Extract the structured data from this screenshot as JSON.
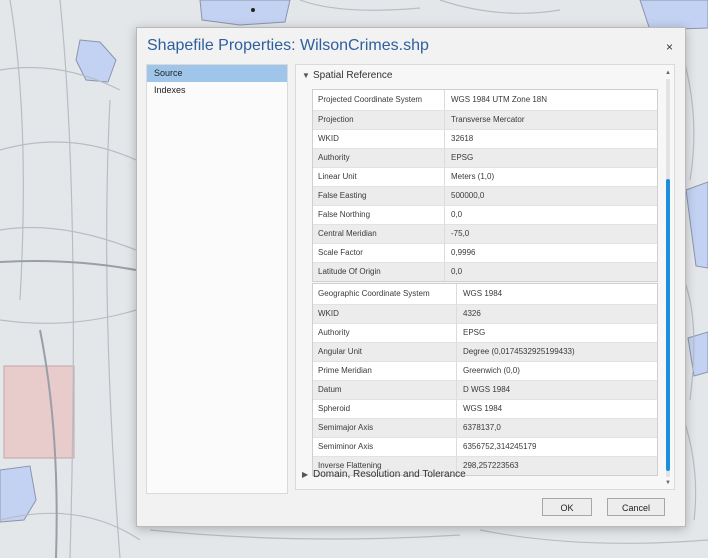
{
  "dialog": {
    "title": "Shapefile Properties: WilsonCrimes.shp",
    "close_glyph": "×"
  },
  "nav": {
    "items": [
      {
        "label": "Source",
        "active": true
      },
      {
        "label": "Indexes",
        "active": false
      }
    ]
  },
  "spatial_reference": {
    "header": "Spatial Reference",
    "expanded": true,
    "projected": [
      {
        "key": "Projected Coordinate System",
        "value": "WGS 1984 UTM Zone 18N"
      },
      {
        "key": "Projection",
        "value": "Transverse Mercator"
      },
      {
        "key": "WKID",
        "value": "32618"
      },
      {
        "key": "Authority",
        "value": "EPSG"
      },
      {
        "key": "Linear Unit",
        "value": "Meters (1,0)"
      },
      {
        "key": "False Easting",
        "value": "500000,0"
      },
      {
        "key": "False Northing",
        "value": "0,0"
      },
      {
        "key": "Central Meridian",
        "value": "-75,0"
      },
      {
        "key": "Scale Factor",
        "value": "0,9996"
      },
      {
        "key": "Latitude Of Origin",
        "value": "0,0"
      }
    ],
    "geographic": [
      {
        "key": "Geographic Coordinate System",
        "value": "WGS 1984"
      },
      {
        "key": "WKID",
        "value": "4326"
      },
      {
        "key": "Authority",
        "value": "EPSG"
      },
      {
        "key": "Angular Unit",
        "value": "Degree (0,0174532925199433)"
      },
      {
        "key": "Prime Meridian",
        "value": "Greenwich (0,0)"
      },
      {
        "key": "Datum",
        "value": "D WGS 1984"
      },
      {
        "key": "Spheroid",
        "value": "WGS 1984"
      },
      {
        "key": "Semimajor Axis",
        "value": "6378137,0"
      },
      {
        "key": "Semiminor Axis",
        "value": "6356752,314245179"
      },
      {
        "key": "Inverse Flattening",
        "value": "298,257223563"
      }
    ]
  },
  "domain_section": {
    "header": "Domain, Resolution and Tolerance",
    "expanded": false
  },
  "buttons": {
    "ok": "OK",
    "cancel": "Cancel"
  },
  "colors": {
    "title": "#2d5f9e",
    "nav_active": "#9fc6ea",
    "scroll_thumb": "#1c8fdc",
    "map_water": "#c3d2f2"
  },
  "icons": {
    "close": "close-icon",
    "section_expanded": "chevron-down-icon",
    "section_collapsed": "chevron-right-icon"
  }
}
